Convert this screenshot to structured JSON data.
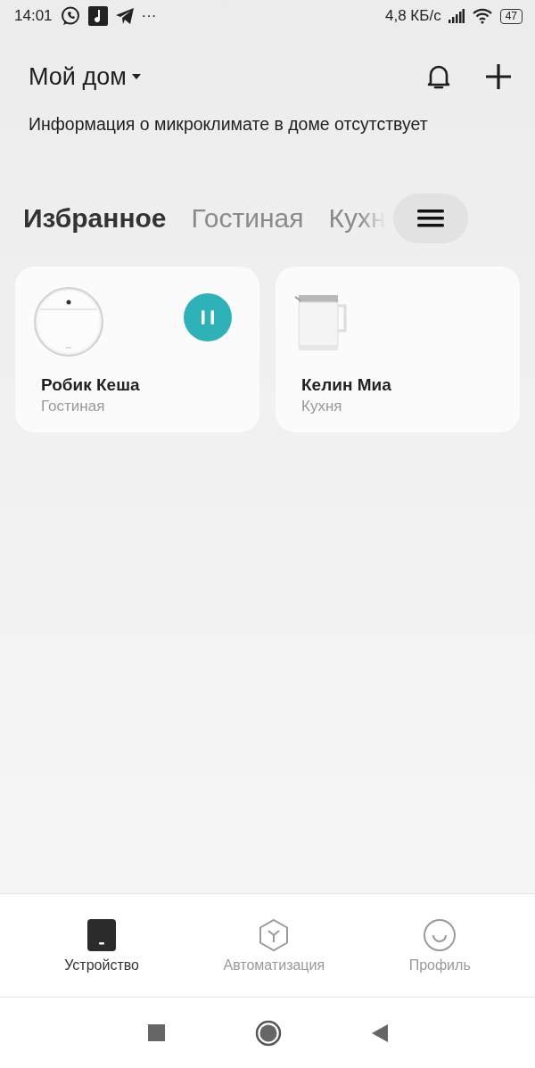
{
  "status_bar": {
    "time": "14:01",
    "more": "···",
    "network_speed": "4,8 КБ/с",
    "battery": "47"
  },
  "header": {
    "home": "Мой дом"
  },
  "climate_info": "Информация о микроклимате в доме отсутствует",
  "tabs": [
    {
      "label": "Избранное",
      "selected": true
    },
    {
      "label": "Гостиная",
      "selected": false
    },
    {
      "label": "Кухн",
      "selected": false
    }
  ],
  "devices": [
    {
      "name": "Робик Кеша",
      "room": "Гостиная",
      "kind": "robot",
      "running": true
    },
    {
      "name": "Келин Миа",
      "room": "Кухня",
      "kind": "kettle",
      "running": false
    }
  ],
  "bottom_nav": [
    {
      "label": "Устройство",
      "kind": "device",
      "selected": true
    },
    {
      "label": "Автоматизация",
      "kind": "automation",
      "selected": false
    },
    {
      "label": "Профиль",
      "kind": "profile",
      "selected": false
    }
  ]
}
